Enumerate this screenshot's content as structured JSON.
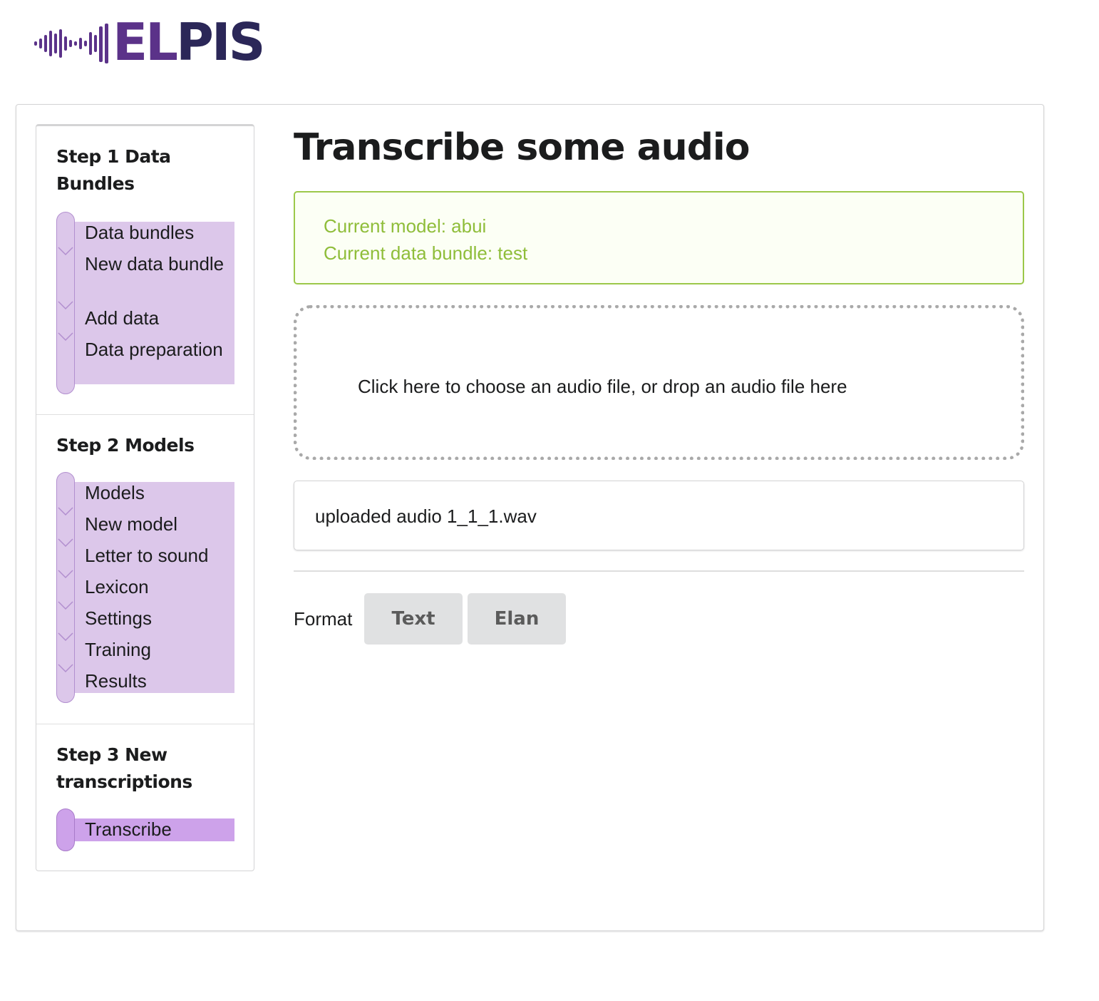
{
  "brand": {
    "logo_text_el": "EL",
    "logo_text_pis": "PIS",
    "logo_icon": "waveform-icon"
  },
  "sidebar": {
    "steps": [
      {
        "title": "Step 1 Data Bundles",
        "items": [
          "Data bundles",
          "New data bundle",
          "Add data",
          "Data preparation"
        ]
      },
      {
        "title": "Step 2 Models",
        "items": [
          "Models",
          "New model",
          "Letter to sound",
          "Lexicon",
          "Settings",
          "Training",
          "Results"
        ]
      },
      {
        "title": "Step 3 New transcriptions",
        "items": [
          "Transcribe"
        ],
        "active": "Transcribe"
      }
    ]
  },
  "main": {
    "title": "Transcribe some audio",
    "info": {
      "model_line": "Current model: abui",
      "bundle_line": "Current data bundle: test"
    },
    "dropzone_text": "Click here to choose an audio file, or drop an audio file here",
    "uploaded_text": "uploaded audio 1_1_1.wav",
    "format_label": "Format",
    "format_buttons": [
      "Text",
      "Elan"
    ]
  },
  "colors": {
    "brand_purple": "#5b3289",
    "brand_navy": "#2b2758",
    "step_bg": "#dcc7ea",
    "step_active_bg": "#cda2ea",
    "info_green": "#8fbd3a",
    "info_bg": "#fcfff5"
  }
}
